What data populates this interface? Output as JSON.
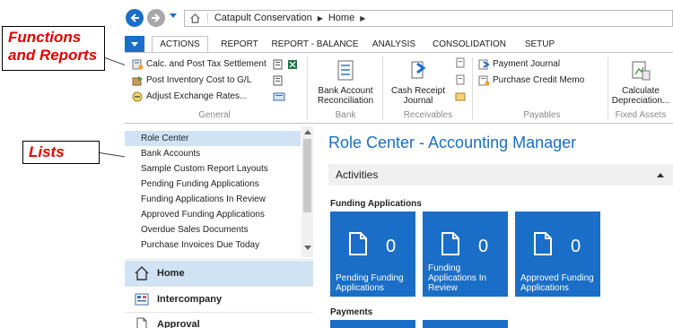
{
  "annotations": {
    "functions_and_reports": "Functions and Reports",
    "lists": "Lists"
  },
  "address_bar": {
    "company": "Catapult Conservation",
    "page": "Home"
  },
  "ribbon": {
    "tabs": [
      {
        "label": "ACTIONS",
        "active": true
      },
      {
        "label": "REPORT",
        "active": false
      },
      {
        "label": "REPORT - BALANCE",
        "active": false
      },
      {
        "label": "ANALYSIS",
        "active": false
      },
      {
        "label": "CONSOLIDATION",
        "active": false
      },
      {
        "label": "SETUP",
        "active": false
      }
    ],
    "general": {
      "actions": [
        "Calc. and Post Tax Settlement",
        "Post Inventory Cost to G/L",
        "Adjust Exchange Rates..."
      ],
      "label": "General"
    },
    "bank": {
      "action": "Bank Account Reconciliation",
      "label": "Bank"
    },
    "receivables": {
      "action": "Cash Receipt Journal",
      "label": "Receivables"
    },
    "payables": {
      "actions": [
        "Payment Journal",
        "Purchase Credit Memo"
      ],
      "label": "Payables"
    },
    "fixed_assets": {
      "action": "Calculate Depreciation...",
      "label": "Fixed Assets"
    }
  },
  "nav_list": {
    "items": [
      "Role Center",
      "Bank Accounts",
      "Sample Custom Report Layouts",
      "Pending Funding Applications",
      "Funding Applications In Review",
      "Approved Funding Applications",
      "Overdue Sales Documents",
      "Purchase Invoices Due Today"
    ],
    "selected_index": 0
  },
  "nav_sections": [
    "Home",
    "Intercompany",
    "Approval"
  ],
  "content": {
    "title": "Role Center - Accounting Manager",
    "activities_label": "Activities",
    "funding_section": "Funding Applications",
    "payments_section": "Payments",
    "tiles": [
      {
        "count": "0",
        "label": "Pending Funding Applications"
      },
      {
        "count": "0",
        "label": "Funding Applications In Review"
      },
      {
        "count": "0",
        "label": "Approved Funding Applications"
      }
    ]
  },
  "colors": {
    "accent": "#1a6ec7",
    "annotation": "#e00000",
    "selection": "#cfe3f5"
  }
}
